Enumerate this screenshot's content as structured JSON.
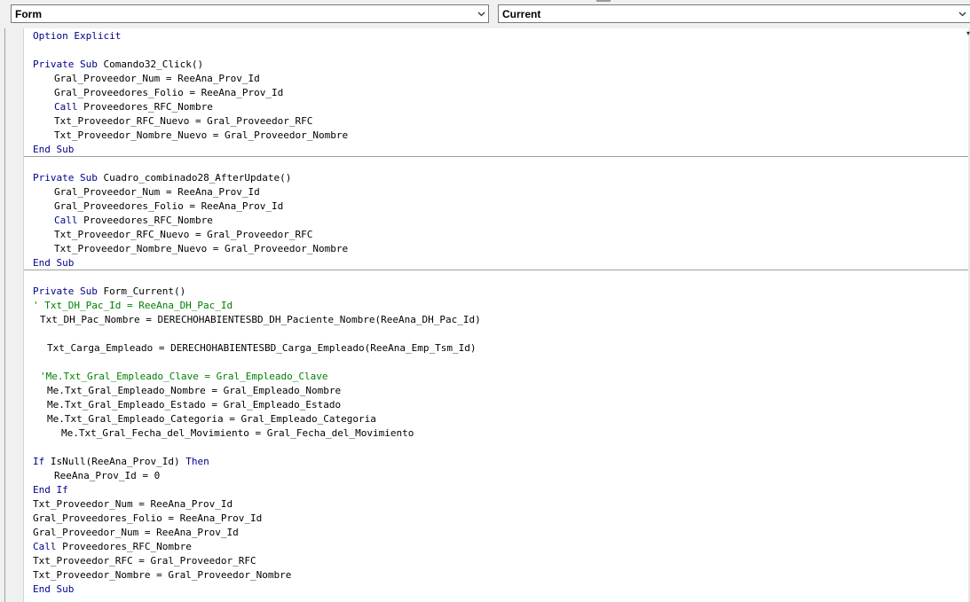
{
  "object_combo": {
    "value": "Form"
  },
  "procedure_combo": {
    "value": "Current"
  },
  "code": {
    "lines": [
      {
        "indent": 0,
        "segs": [
          {
            "k": "kw",
            "t": "Option Explicit"
          }
        ]
      },
      {
        "indent": 0,
        "segs": []
      },
      {
        "indent": 0,
        "segs": [
          {
            "k": "kw",
            "t": "Private Sub"
          },
          {
            "k": "p",
            "t": " Comando32_Click()"
          }
        ]
      },
      {
        "indent": 3,
        "segs": [
          {
            "k": "p",
            "t": "Gral_Proveedor_Num = ReeAna_Prov_Id"
          }
        ]
      },
      {
        "indent": 3,
        "segs": [
          {
            "k": "p",
            "t": "Gral_Proveedores_Folio = ReeAna_Prov_Id"
          }
        ]
      },
      {
        "indent": 3,
        "segs": [
          {
            "k": "kw",
            "t": "Call"
          },
          {
            "k": "p",
            "t": " Proveedores_RFC_Nombre"
          }
        ]
      },
      {
        "indent": 3,
        "segs": [
          {
            "k": "p",
            "t": "Txt_Proveedor_RFC_Nuevo = Gral_Proveedor_RFC"
          }
        ]
      },
      {
        "indent": 3,
        "segs": [
          {
            "k": "p",
            "t": "Txt_Proveedor_Nombre_Nuevo = Gral_Proveedor_Nombre"
          }
        ]
      },
      {
        "indent": 0,
        "segs": [
          {
            "k": "kw",
            "t": "End Sub"
          }
        ]
      },
      {
        "indent": 0,
        "segs": []
      },
      {
        "indent": 0,
        "segs": [
          {
            "k": "kw",
            "t": "Private Sub"
          },
          {
            "k": "p",
            "t": " Cuadro_combinado28_AfterUpdate()"
          }
        ]
      },
      {
        "indent": 3,
        "segs": [
          {
            "k": "p",
            "t": "Gral_Proveedor_Num = ReeAna_Prov_Id"
          }
        ]
      },
      {
        "indent": 3,
        "segs": [
          {
            "k": "p",
            "t": "Gral_Proveedores_Folio = ReeAna_Prov_Id"
          }
        ]
      },
      {
        "indent": 3,
        "segs": [
          {
            "k": "kw",
            "t": "Call"
          },
          {
            "k": "p",
            "t": " Proveedores_RFC_Nombre"
          }
        ]
      },
      {
        "indent": 3,
        "segs": [
          {
            "k": "p",
            "t": "Txt_Proveedor_RFC_Nuevo = Gral_Proveedor_RFC"
          }
        ]
      },
      {
        "indent": 3,
        "segs": [
          {
            "k": "p",
            "t": "Txt_Proveedor_Nombre_Nuevo = Gral_Proveedor_Nombre"
          }
        ]
      },
      {
        "indent": 0,
        "segs": [
          {
            "k": "kw",
            "t": "End Sub"
          }
        ]
      },
      {
        "indent": 0,
        "segs": []
      },
      {
        "indent": 0,
        "segs": [
          {
            "k": "kw",
            "t": "Private Sub"
          },
          {
            "k": "p",
            "t": " Form_Current()"
          }
        ]
      },
      {
        "indent": 0,
        "segs": [
          {
            "k": "cm",
            "t": "' Txt_DH_Pac_Id = ReeAna_DH_Pac_Id"
          }
        ]
      },
      {
        "indent": 1,
        "segs": [
          {
            "k": "p",
            "t": "Txt_DH_Pac_Nombre = DERECHOHABIENTESBD_DH_Paciente_Nombre(ReeAna_DH_Pac_Id)"
          }
        ]
      },
      {
        "indent": 0,
        "segs": []
      },
      {
        "indent": 2,
        "segs": [
          {
            "k": "p",
            "t": "Txt_Carga_Empleado = DERECHOHABIENTESBD_Carga_Empleado(ReeAna_Emp_Tsm_Id)"
          }
        ]
      },
      {
        "indent": 0,
        "segs": []
      },
      {
        "indent": 1,
        "segs": [
          {
            "k": "cm",
            "t": "'Me.Txt_Gral_Empleado_Clave = Gral_Empleado_Clave"
          }
        ]
      },
      {
        "indent": 2,
        "segs": [
          {
            "k": "p",
            "t": "Me.Txt_Gral_Empleado_Nombre = Gral_Empleado_Nombre"
          }
        ]
      },
      {
        "indent": 2,
        "segs": [
          {
            "k": "p",
            "t": "Me.Txt_Gral_Empleado_Estado = Gral_Empleado_Estado"
          }
        ]
      },
      {
        "indent": 2,
        "segs": [
          {
            "k": "p",
            "t": "Me.Txt_Gral_Empleado_Categoria = Gral_Empleado_Categoria"
          }
        ]
      },
      {
        "indent": 4,
        "segs": [
          {
            "k": "p",
            "t": "Me.Txt_Gral_Fecha_del_Movimiento = Gral_Fecha_del_Movimiento"
          }
        ]
      },
      {
        "indent": 0,
        "segs": []
      },
      {
        "indent": 0,
        "segs": [
          {
            "k": "kw",
            "t": "If"
          },
          {
            "k": "p",
            "t": " IsNull(ReeAna_Prov_Id) "
          },
          {
            "k": "kw",
            "t": "Then"
          }
        ]
      },
      {
        "indent": 3,
        "segs": [
          {
            "k": "p",
            "t": "ReeAna_Prov_Id = 0"
          }
        ]
      },
      {
        "indent": 0,
        "segs": [
          {
            "k": "kw",
            "t": "End If"
          }
        ]
      },
      {
        "indent": 0,
        "segs": [
          {
            "k": "p",
            "t": "Txt_Proveedor_Num = ReeAna_Prov_Id"
          }
        ]
      },
      {
        "indent": 0,
        "segs": [
          {
            "k": "p",
            "t": "Gral_Proveedores_Folio = ReeAna_Prov_Id"
          }
        ]
      },
      {
        "indent": 0,
        "segs": [
          {
            "k": "p",
            "t": "Gral_Proveedor_Num = ReeAna_Prov_Id"
          }
        ]
      },
      {
        "indent": 0,
        "segs": [
          {
            "k": "kw",
            "t": "Call"
          },
          {
            "k": "p",
            "t": " Proveedores_RFC_Nombre"
          }
        ]
      },
      {
        "indent": 0,
        "segs": [
          {
            "k": "p",
            "t": "Txt_Proveedor_RFC = Gral_Proveedor_RFC"
          }
        ]
      },
      {
        "indent": 0,
        "segs": [
          {
            "k": "p",
            "t": "Txt_Proveedor_Nombre = Gral_Proveedor_Nombre"
          }
        ]
      },
      {
        "indent": 0,
        "segs": [
          {
            "k": "kw",
            "t": "End Sub"
          }
        ]
      }
    ]
  },
  "colors": {
    "keyword": "#00008b",
    "comment": "#008000",
    "text": "#000000"
  }
}
